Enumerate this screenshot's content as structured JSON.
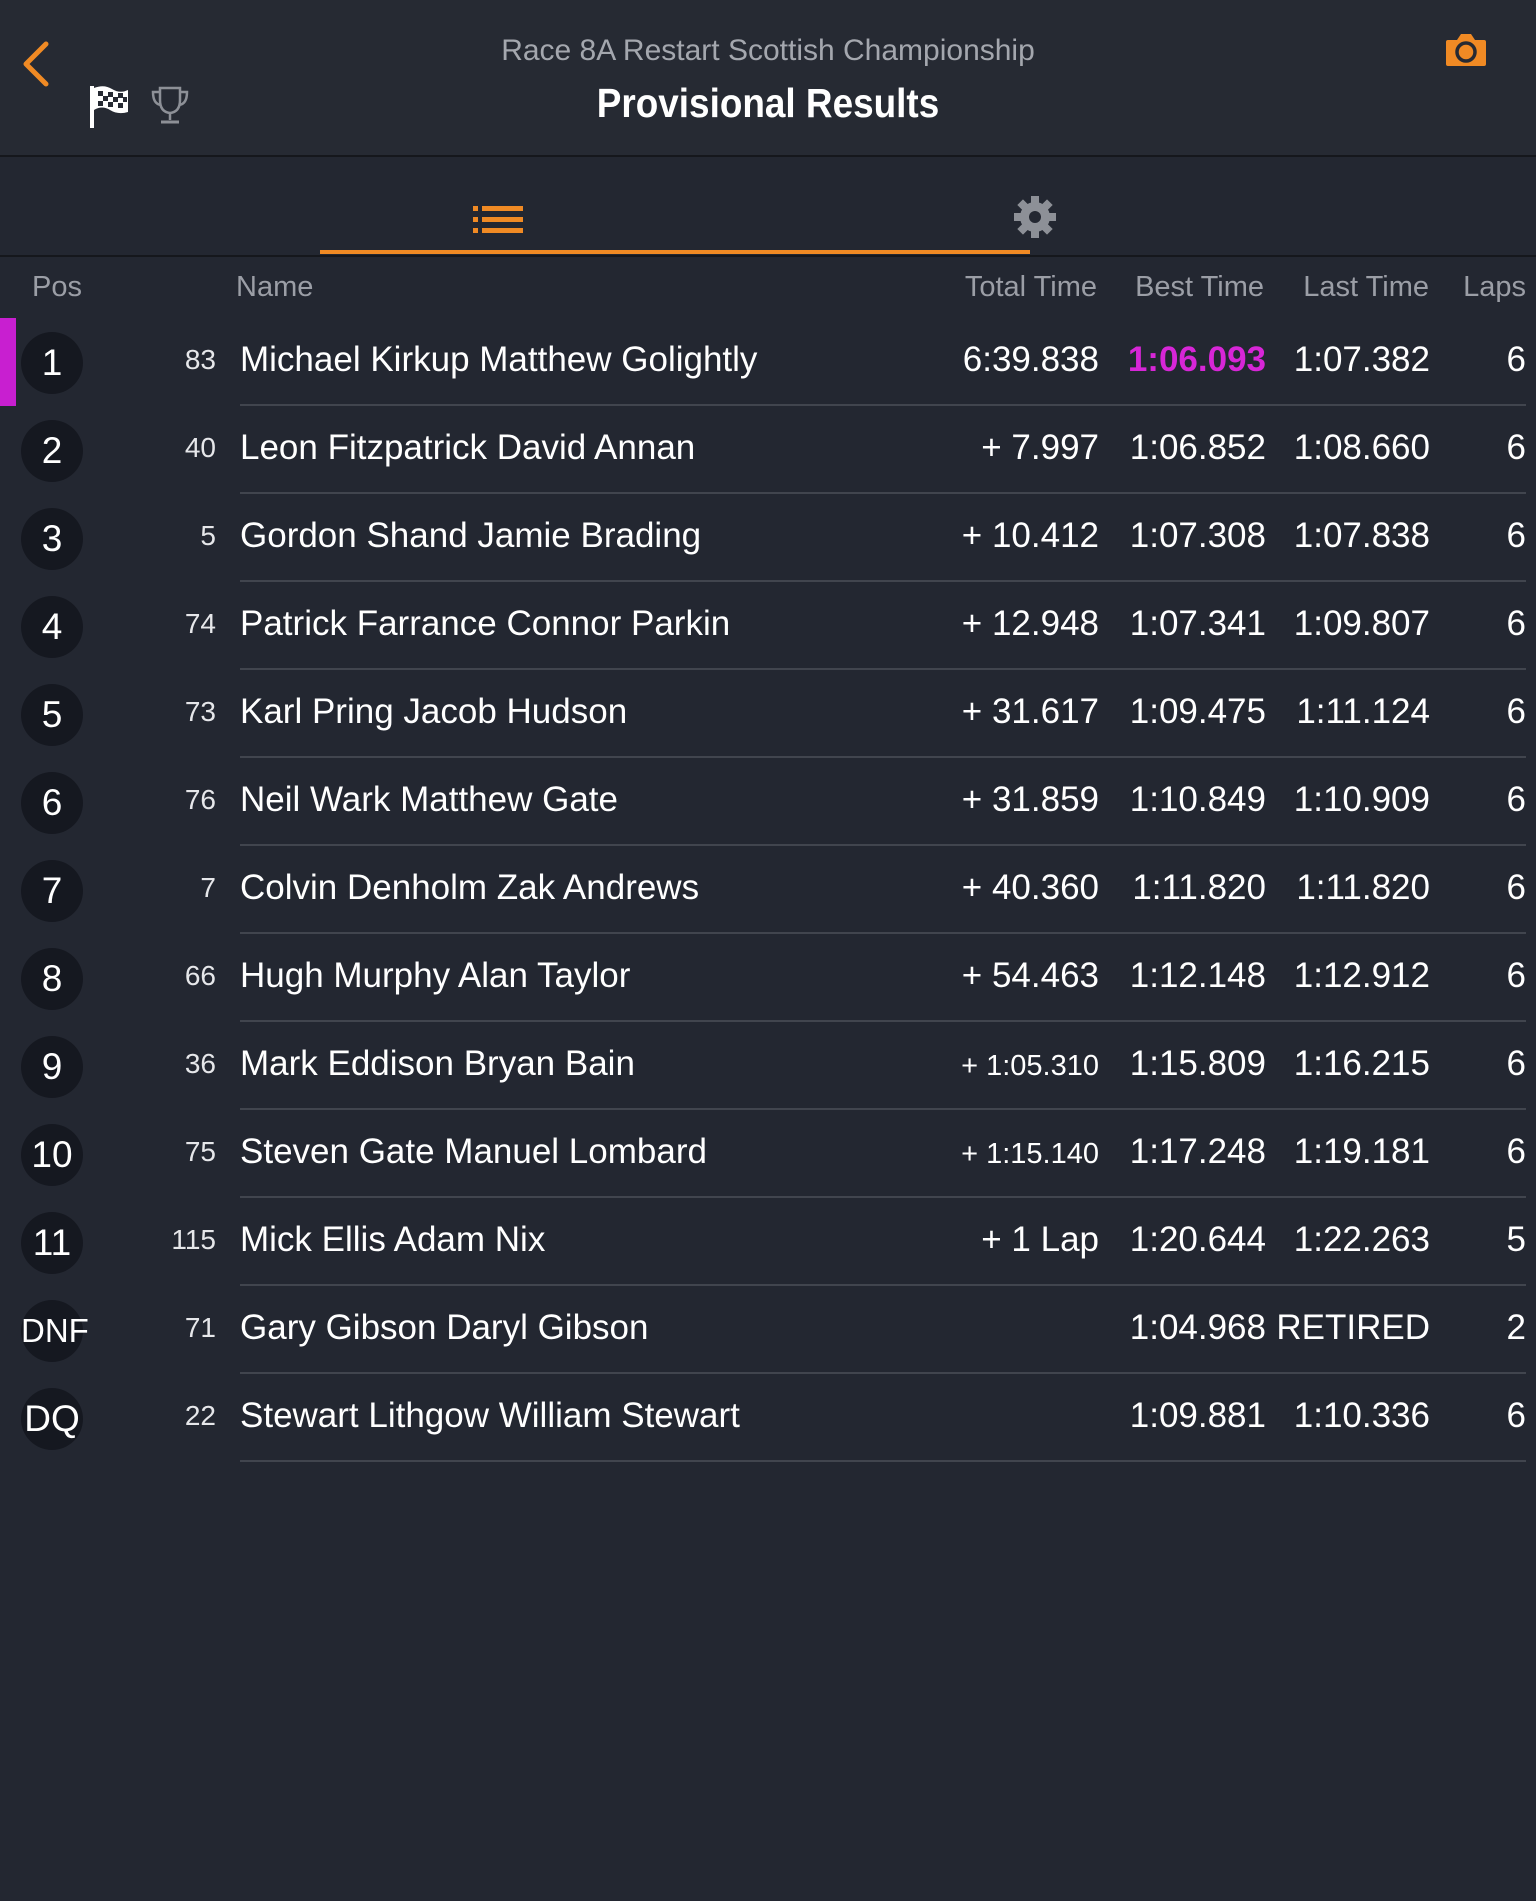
{
  "header": {
    "subtitle": "Race 8A Restart Scottish Championship",
    "title": "Provisional Results"
  },
  "icons": {
    "back": "chevron-left-icon",
    "flag": "checkered-flag-icon",
    "trophy": "trophy-icon",
    "camera": "camera-icon",
    "list": "list-icon",
    "settings": "gear-icon"
  },
  "colors": {
    "accent": "#f08a24",
    "best_lap": "#d726d7",
    "background": "#232731"
  },
  "columns": {
    "pos": "Pos",
    "name": "Name",
    "total": "Total Time",
    "best": "Best Time",
    "last": "Last Time",
    "laps": "Laps"
  },
  "results": [
    {
      "pos": "1",
      "num": "83",
      "name": "Michael Kirkup Matthew Golightly",
      "total": "6:39.838",
      "best": "1:06.093",
      "last": "1:07.382",
      "laps": "6"
    },
    {
      "pos": "2",
      "num": "40",
      "name": "Leon Fitzpatrick David Annan",
      "total": "+ 7.997",
      "best": "1:06.852",
      "last": "1:08.660",
      "laps": "6"
    },
    {
      "pos": "3",
      "num": "5",
      "name": "Gordon Shand Jamie Brading",
      "total": "+ 10.412",
      "best": "1:07.308",
      "last": "1:07.838",
      "laps": "6"
    },
    {
      "pos": "4",
      "num": "74",
      "name": "Patrick Farrance Connor Parkin",
      "total": "+ 12.948",
      "best": "1:07.341",
      "last": "1:09.807",
      "laps": "6"
    },
    {
      "pos": "5",
      "num": "73",
      "name": "Karl Pring Jacob Hudson",
      "total": "+ 31.617",
      "best": "1:09.475",
      "last": "1:11.124",
      "laps": "6"
    },
    {
      "pos": "6",
      "num": "76",
      "name": "Neil Wark Matthew Gate",
      "total": "+ 31.859",
      "best": "1:10.849",
      "last": "1:10.909",
      "laps": "6"
    },
    {
      "pos": "7",
      "num": "7",
      "name": "Colvin Denholm Zak Andrews",
      "total": "+ 40.360",
      "best": "1:11.820",
      "last": "1:11.820",
      "laps": "6"
    },
    {
      "pos": "8",
      "num": "66",
      "name": "Hugh Murphy Alan Taylor",
      "total": "+ 54.463",
      "best": "1:12.148",
      "last": "1:12.912",
      "laps": "6"
    },
    {
      "pos": "9",
      "num": "36",
      "name": "Mark Eddison Bryan Bain",
      "total": "+ 1:05.310",
      "best": "1:15.809",
      "last": "1:16.215",
      "laps": "6"
    },
    {
      "pos": "10",
      "num": "75",
      "name": "Steven Gate Manuel Lombard",
      "total": "+ 1:15.140",
      "best": "1:17.248",
      "last": "1:19.181",
      "laps": "6"
    },
    {
      "pos": "11",
      "num": "115",
      "name": "Mick Ellis Adam Nix",
      "total": "+ 1 Lap",
      "best": "1:20.644",
      "last": "1:22.263",
      "laps": "5"
    },
    {
      "pos": "DNF",
      "num": "71",
      "name": "Gary Gibson Daryl Gibson",
      "total": "",
      "best": "1:04.968",
      "last": "RETIRED",
      "laps": "2"
    },
    {
      "pos": "DQ",
      "num": "22",
      "name": "Stewart Lithgow William Stewart",
      "total": "",
      "best": "1:09.881",
      "last": "1:10.336",
      "laps": "6"
    }
  ]
}
